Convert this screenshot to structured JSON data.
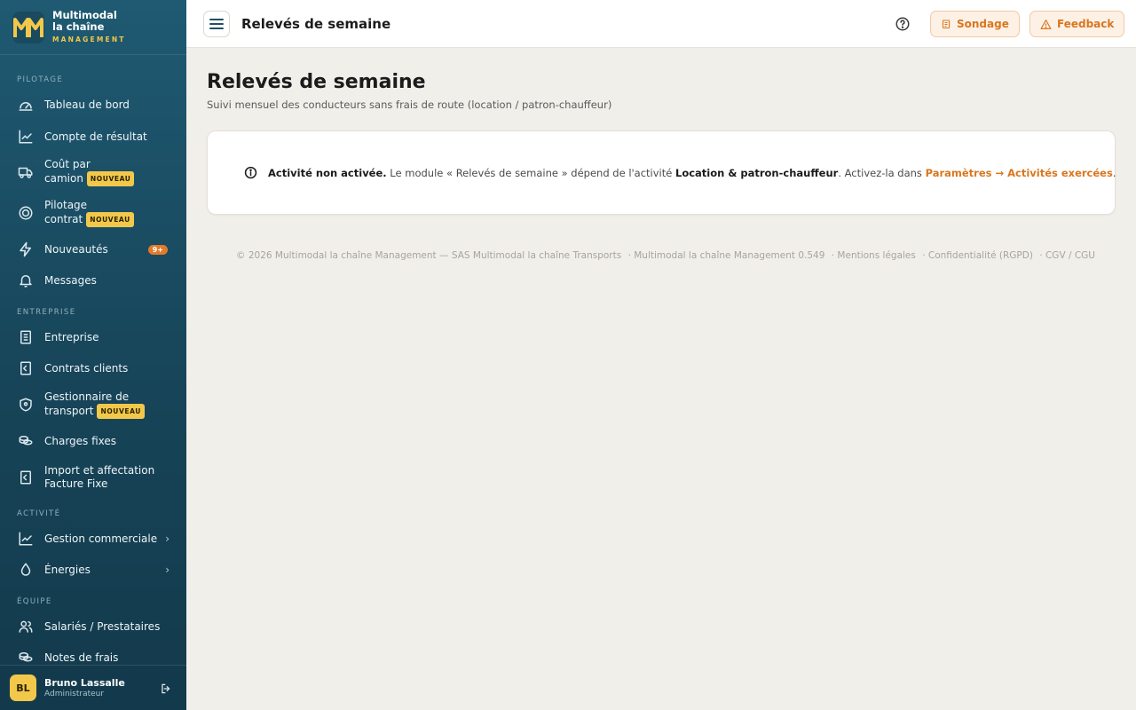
{
  "brand": {
    "line1": "Multimodal",
    "line2": "la chaîne",
    "tagline": "MANAGEMENT",
    "logo_letters": "MM",
    "logo_color": "#f2c84b"
  },
  "sidebar": {
    "sections": {
      "pilotage": "PILOTAGE",
      "entreprise": "ENTREPRISE",
      "activite": "ACTIVITÉ",
      "equipe": "ÉQUIPE"
    },
    "items": [
      {
        "label": "Tableau de bord",
        "icon": "gauge-icon"
      },
      {
        "label": "Compte de résultat",
        "icon": "chart-line-icon"
      },
      {
        "label": "Coût par",
        "label2": "camion",
        "badge": "NOUVEAU",
        "icon": "truck-icon"
      },
      {
        "label": "Pilotage",
        "label2": "contrat",
        "badge": "NOUVEAU",
        "icon": "target-icon"
      },
      {
        "label": "Nouveautés",
        "count": "9+",
        "icon": "bolt-icon"
      },
      {
        "label": "Messages",
        "icon": "bell-icon"
      },
      {
        "label": "Entreprise",
        "icon": "building-icon"
      },
      {
        "label": "Contrats clients",
        "icon": "contract-icon"
      },
      {
        "label": "Gestionnaire de",
        "label2": "transport",
        "badge": "NOUVEAU",
        "icon": "shield-icon"
      },
      {
        "label": "Charges fixes",
        "icon": "coins-icon"
      },
      {
        "label": "Import et affectation",
        "label2": "Facture Fixe",
        "icon": "invoice-icon"
      },
      {
        "label": "Gestion commerciale",
        "icon": "chart-line-icon"
      },
      {
        "label": "Énergies",
        "icon": "drop-icon"
      },
      {
        "label": "Salariés / Prestataires",
        "icon": "users-icon"
      },
      {
        "label": "Notes de frais",
        "icon": "coins-icon"
      }
    ],
    "user": {
      "initials": "BL",
      "name": "Bruno Lassalle",
      "role": "Administrateur"
    }
  },
  "topbar": {
    "title": "Relevés de semaine",
    "survey_label": "Sondage",
    "feedback_label": "Feedback"
  },
  "page": {
    "title": "Relevés de semaine",
    "subtitle": "Suivi mensuel des conducteurs sans frais de route (location / patron-chauffeur)",
    "notice": {
      "strong": "Activité non activée.",
      "text1": " Le module « Relevés de semaine » dépend de l'activité ",
      "activity": "Location & patron-chauffeur",
      "text2": ". Activez-la dans ",
      "link": "Paramètres → Activités exercées",
      "end": "."
    }
  },
  "footer": {
    "copyright": "© 2026 Multimodal la chaîne Management — SAS Multimodal la chaîne Transports",
    "version": "· Multimodal la chaîne Management 0.549",
    "legal": "· Mentions légales",
    "privacy": "· Confidentialité (RGPD)",
    "terms": "· CGV / CGU"
  },
  "colors": {
    "accent": "#d9761e",
    "sidebar": "#174458",
    "badge": "#f2c84b"
  }
}
